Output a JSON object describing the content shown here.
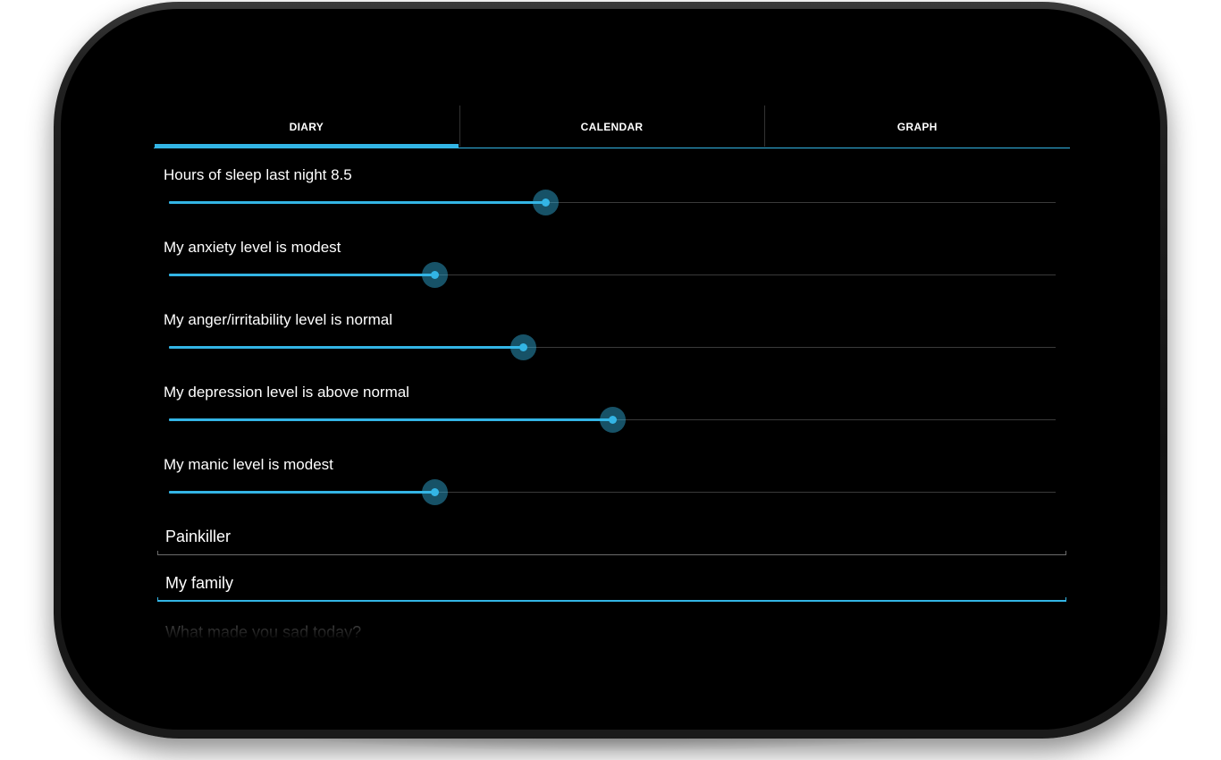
{
  "tabs": [
    {
      "label": "DIARY",
      "active": true
    },
    {
      "label": "CALENDAR",
      "active": false
    },
    {
      "label": "GRAPH",
      "active": false
    }
  ],
  "sliders": [
    {
      "label": "Hours of sleep last night 8.5",
      "value_fraction": 0.424
    },
    {
      "label": "My anxiety level is modest",
      "value_fraction": 0.299
    },
    {
      "label": "My anger/irritability level is normal",
      "value_fraction": 0.399
    },
    {
      "label": "My depression level is above normal",
      "value_fraction": 0.5
    },
    {
      "label": "My manic level is modest",
      "value_fraction": 0.299
    }
  ],
  "fields": {
    "painkiller": {
      "value": "Painkiller"
    },
    "family": {
      "value": "My family"
    },
    "sad": {
      "placeholder": "What made you sad today?"
    }
  },
  "colors": {
    "accent": "#33b5e5",
    "background": "#000000",
    "text": "#ffffff"
  }
}
